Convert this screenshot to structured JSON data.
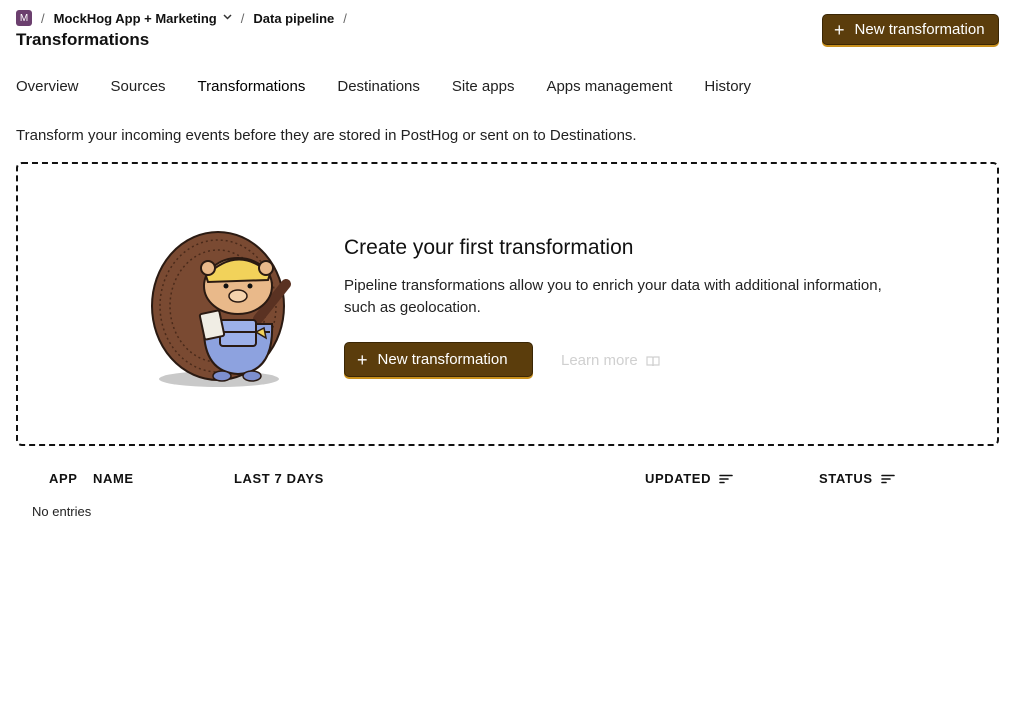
{
  "breadcrumb": {
    "org_initial": "M",
    "project": "MockHog App + Marketing",
    "section": "Data pipeline",
    "separator": "/"
  },
  "page_title": "Transformations",
  "header_button": "New transformation",
  "tabs": [
    {
      "label": "Overview"
    },
    {
      "label": "Sources"
    },
    {
      "label": "Transformations",
      "active": true
    },
    {
      "label": "Destinations"
    },
    {
      "label": "Site apps"
    },
    {
      "label": "Apps management"
    },
    {
      "label": "History"
    }
  ],
  "intro": "Transform your incoming events before they are stored in PostHog or sent on to Destinations.",
  "empty_state": {
    "title": "Create your first transformation",
    "description": "Pipeline transformations allow you to enrich your data with additional information, such as geolocation.",
    "button": "New transformation",
    "learn_more": "Learn more"
  },
  "table": {
    "columns": [
      "APP",
      "NAME",
      "LAST 7 DAYS",
      "UPDATED",
      "STATUS"
    ],
    "empty_text": "No entries"
  },
  "colors": {
    "primary_button": "#5b3d0c",
    "primary_button_accent": "#c9901c",
    "org_badge": "#6b3f6e"
  }
}
